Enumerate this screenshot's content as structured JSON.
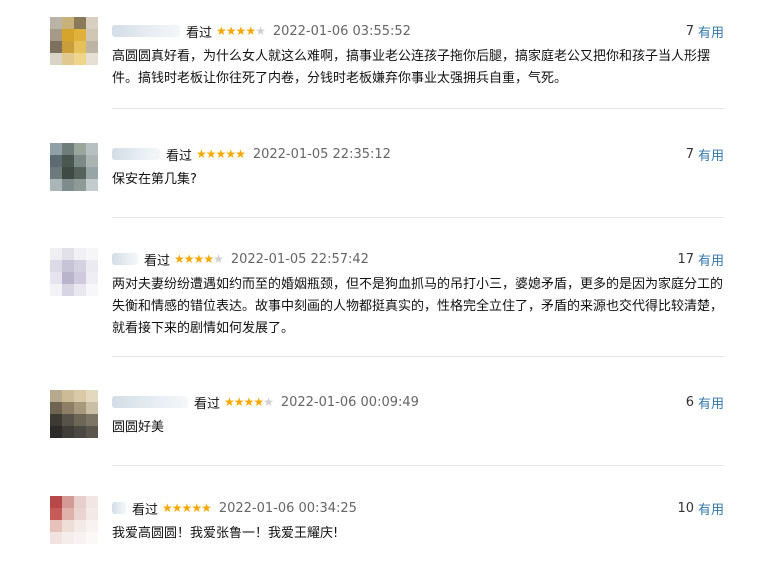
{
  "comments": [
    {
      "status": "看过",
      "rating": 4,
      "time": "2022-01-06 03:55:52",
      "useful_count": "7",
      "useful_label": "有用",
      "text": "高圆圆真好看，为什么女人就这么难啊，搞事业老公连孩子拖你后腿，搞家庭老公又把你和孩子当人形摆件。搞钱时老板让你往死了内卷，分钱时老板嫌弃你事业太强拥兵自重，气死。",
      "avatar_palette": [
        "#b9b3a8",
        "#c9b27a",
        "#8a7a5c",
        "#d8cfc0",
        "#a69a87",
        "#d4a52a",
        "#e0b23c",
        "#cfc6b4",
        "#7d705e",
        "#c89d3a",
        "#e6c15a",
        "#bdb4a3",
        "#d9d2c6",
        "#e1c88e",
        "#f0d48a",
        "#e6dfd3"
      ]
    },
    {
      "status": "看过",
      "rating": 5,
      "time": "2022-01-05 22:35:12",
      "useful_count": "7",
      "useful_label": "有用",
      "text": "保安在第几集?",
      "avatar_palette": [
        "#8fa0a6",
        "#6f7d7a",
        "#9aa59c",
        "#b7c0c1",
        "#5d6b70",
        "#4a5650",
        "#7b8a86",
        "#a9b4b3",
        "#6c7a7c",
        "#3f4a45",
        "#56625c",
        "#98a5a6",
        "#a9b5b6",
        "#7e8c8c",
        "#8d9a98",
        "#c3cccd"
      ]
    },
    {
      "status": "看过",
      "rating": 4,
      "time": "2022-01-05 22:57:42",
      "useful_count": "17",
      "useful_label": "有用",
      "text": "两对夫妻纷纷遭遇如约而至的婚姻瓶颈，但不是狗血抓马的吊打小三，婆媳矛盾，更多的是因为家庭分工的失衡和情感的错位表达。故事中刻画的人物都挺真实的，性格完全立住了，矛盾的来源也交代得比较清楚，就看接下来的剧情如何发展了。",
      "avatar_palette": [
        "#eeeef3",
        "#e2e1ea",
        "#f1f0f5",
        "#f6f6f9",
        "#dcdae6",
        "#c8c4d8",
        "#d4d1e0",
        "#eceaf1",
        "#e6e4ee",
        "#b9b4cc",
        "#cfcbdd",
        "#efeef4",
        "#f3f2f7",
        "#d7d4e3",
        "#e9e7f0",
        "#f7f7fa"
      ]
    },
    {
      "status": "看过",
      "rating": 4,
      "time": "2022-01-06 00:09:49",
      "useful_count": "6",
      "useful_label": "有用",
      "text": "圆圆好美",
      "avatar_palette": [
        "#b7a98e",
        "#cdbb98",
        "#d9c9a7",
        "#e4d8bf",
        "#6e6452",
        "#8c7f66",
        "#a5987b",
        "#c9bea6",
        "#3c3a33",
        "#57524a",
        "#6d6656",
        "#7c7566",
        "#2c2b27",
        "#3f3d37",
        "#4b4841",
        "#5a564d"
      ]
    },
    {
      "status": "看过",
      "rating": 5,
      "time": "2022-01-06 00:34:25",
      "useful_count": "10",
      "useful_label": "有用",
      "text": "我爱高圆圆！我爱张鲁一！我爱王耀庆!",
      "avatar_palette": [
        "#b8484a",
        "#d49b96",
        "#e8cfcb",
        "#f1e6e3",
        "#c65b59",
        "#e0b1aa",
        "#e9d4cf",
        "#f3eae7",
        "#e7c2bb",
        "#efddd8",
        "#f4ebe8",
        "#f8f3f1",
        "#f1e4e0",
        "#f5edeb",
        "#f8f3f2",
        "#fbf8f7"
      ]
    }
  ]
}
